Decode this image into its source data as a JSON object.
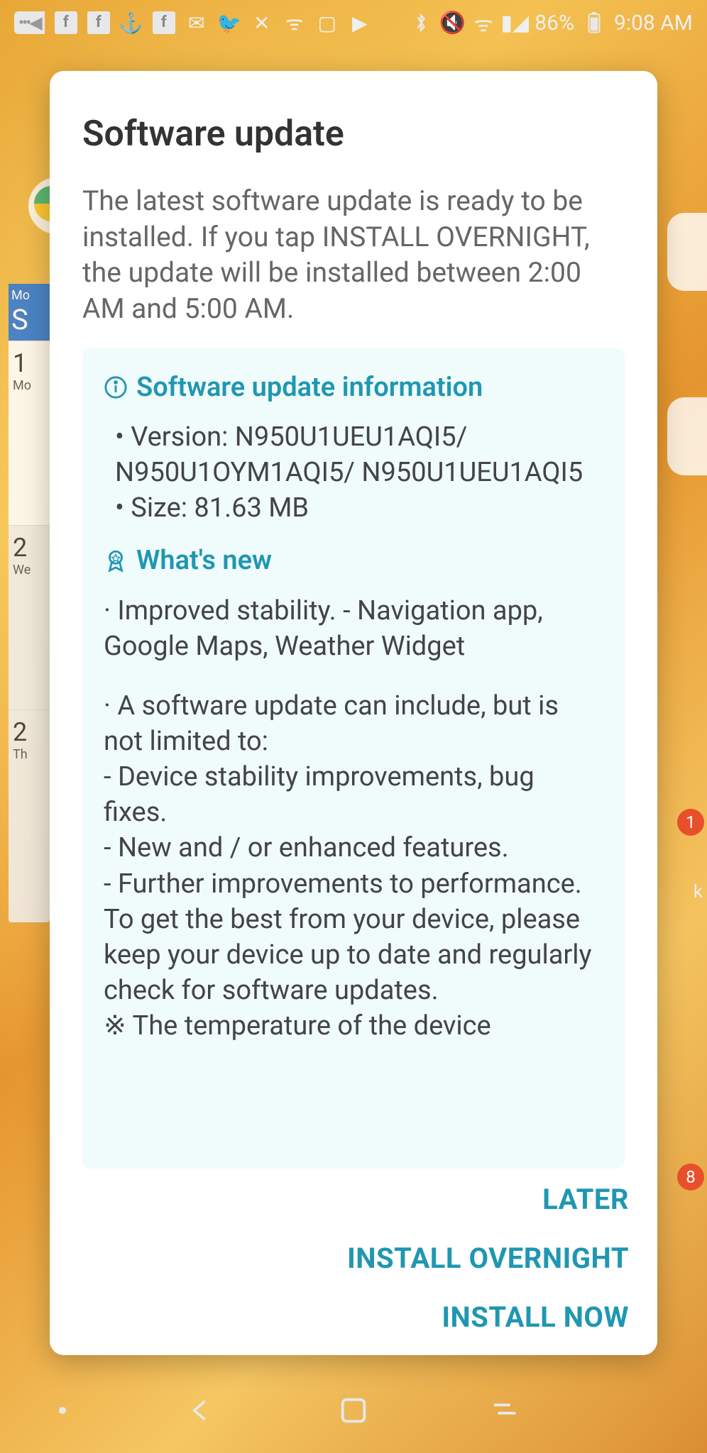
{
  "statusbar": {
    "battery_pct": "86%",
    "time": "9:08 AM"
  },
  "bg": {
    "cal_head_dow": "Mo",
    "cal_head_day": "S",
    "cal_r1_num": "1",
    "cal_r1_dow": "Mo",
    "cal_r2_num": "2",
    "cal_r2_dow": "We",
    "cal_r3_num": "2",
    "cal_r3_dow": "Th",
    "badge1": "1",
    "badge2": "8",
    "icon_label": "k"
  },
  "dialog": {
    "title": "Software update",
    "description": "The latest software update is ready to be installed. If you tap INSTALL OVERNIGHT, the update will be installed between 2:00 AM and 5:00 AM.",
    "info": {
      "heading": "Software update information",
      "version_label": "Version: N950U1UEU1AQI5/ N950U1OYM1AQI5/ N950U1UEU1AQI5",
      "size_label": "Size: 81.63 MB"
    },
    "whatsnew": {
      "heading": "What's new",
      "note1": "Improved stability. - Navigation app, Google Maps, Weather Widget",
      "note2": "A software update can include, but is not limited to:",
      "sub1": "Device stability improvements, bug fixes.",
      "sub2": "New and / or enhanced features.",
      "sub3": "Further improvements to performance.",
      "tail": "To get the best from your device, please keep your device up to date and regularly check for software updates.",
      "footnote": "The temperature of the device"
    },
    "actions": {
      "later": "LATER",
      "overnight": "INSTALL OVERNIGHT",
      "now": "INSTALL NOW"
    }
  }
}
